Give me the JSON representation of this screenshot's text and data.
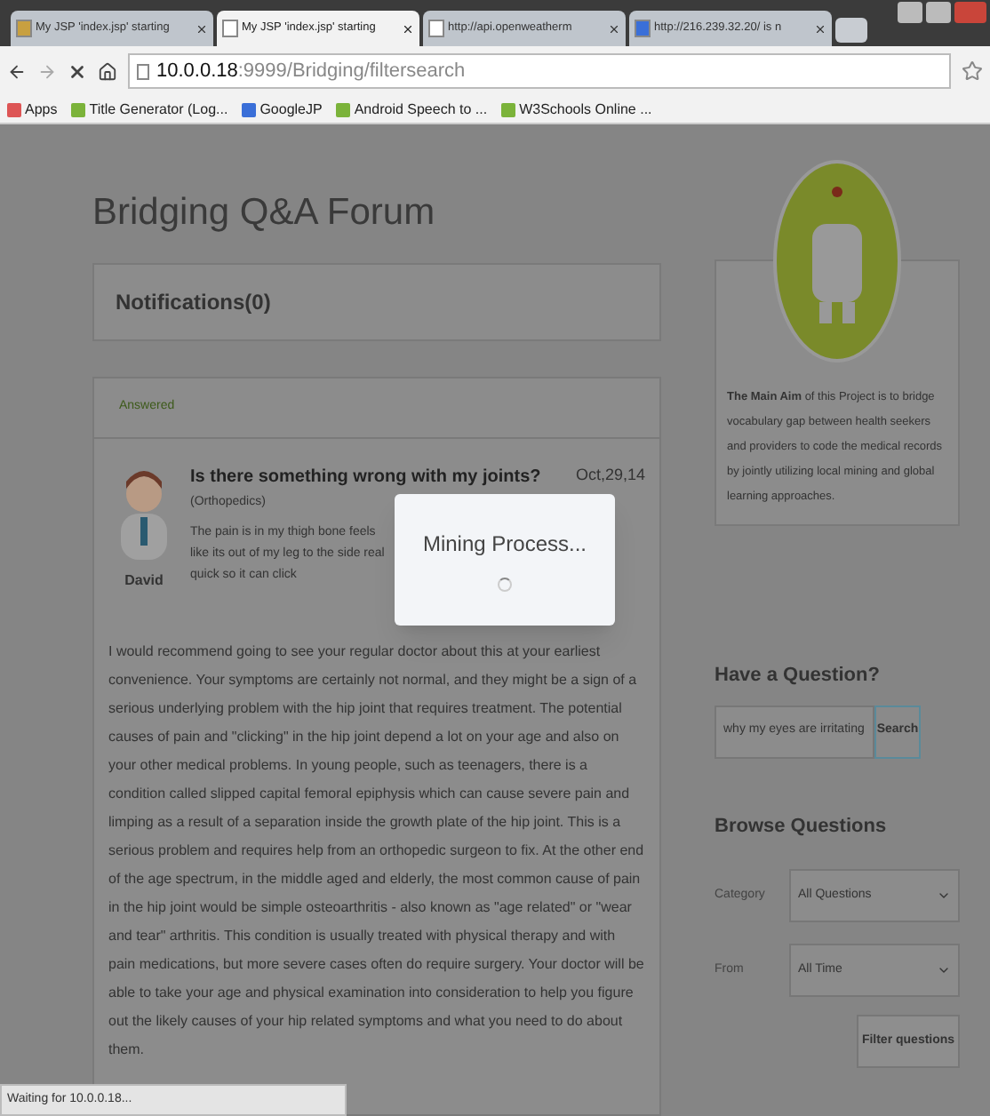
{
  "browser": {
    "tabs": [
      {
        "title": "My JSP 'index.jsp' starting",
        "selected": false
      },
      {
        "title": "My JSP 'index.jsp' starting",
        "selected": true
      },
      {
        "title": "http://api.openweatherm",
        "selected": false
      },
      {
        "title": "http://216.239.32.20/ is n",
        "selected": false
      }
    ],
    "address": {
      "host": "10.0.0.18",
      "path": ":9999/Bridging/filtersearch"
    },
    "bookmarks": [
      {
        "label": "Apps"
      },
      {
        "label": "Title Generator (Log..."
      },
      {
        "label": "GoogleJP"
      },
      {
        "label": "Android Speech to ..."
      },
      {
        "label": "W3Schools Online ..."
      }
    ],
    "status": "Waiting for 10.0.0.18..."
  },
  "page": {
    "title": "Bridging Q&A Forum",
    "notifications": "Notifications(0)",
    "question_card": {
      "status": "Answered",
      "title": "Is there something wrong with my joints?",
      "category": "(Orthopedics)",
      "date": "Oct,29,14",
      "body": "The pain is in my thigh bone feels like its out of",
      "body_2": "my leg to the side real quick so it can click",
      "author": "David",
      "answer": "I would recommend going to see your regular doctor about this at your earliest convenience. Your symptoms are certainly not normal, and they might be a sign of a serious underlying problem with the hip joint that requires treatment. The potential causes of pain and \"clicking\" in the hip joint depend a lot on your age and also on your other medical problems. In young people, such as teenagers, there is a condition called slipped capital femoral epiphysis which can cause severe pain and limping as a result of a separation inside the growth plate of the hip joint. This is a serious problem and requires help from an orthopedic surgeon to fix. At the other end of the age spectrum, in the middle aged and elderly, the most common cause of pain in the hip joint would be simple osteoarthritis - also known as \"age related\" or \"wear and tear\" arthritis. This condition is usually treated with physical therapy and with pain medications, but more severe cases often do require surgery. Your doctor will be able to take your age and physical examination into consideration to help you figure out the likely causes of your hip related symptoms and what you need to do about them."
    },
    "aim": "**The Main Aim** of this Project is to bridge vocabulary gap between health seekers and providers to code the medical records by jointly utilizing local mining and global learning approaches.",
    "ask": {
      "heading": "Have a Question?",
      "value": "why my eyes are irritating",
      "button": "Search"
    },
    "browse": {
      "heading": "Browse Questions",
      "filters": [
        {
          "label": "Category",
          "value": "All Questions"
        },
        {
          "label": "From",
          "value": "All Time"
        }
      ],
      "button": "Filter questions"
    }
  },
  "dialog": {
    "message": "Mining Process..."
  }
}
